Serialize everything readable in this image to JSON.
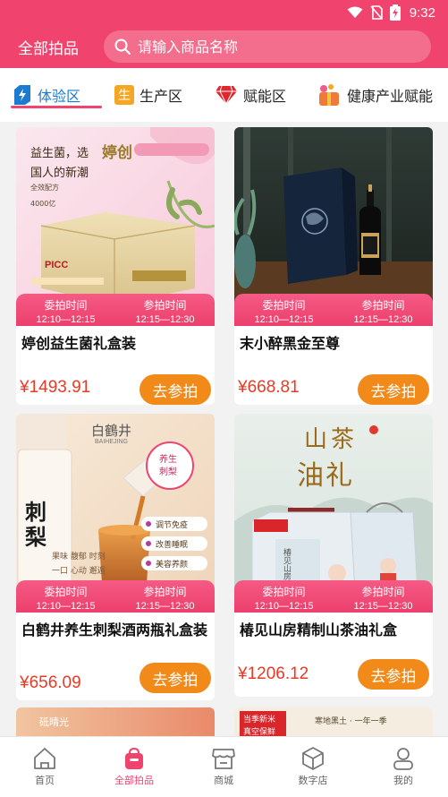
{
  "status_bar": {
    "time": "9:32",
    "icons": [
      "wifi-icon",
      "no-sim-icon",
      "battery-charging-icon"
    ]
  },
  "header": {
    "title": "全部拍品",
    "search_placeholder": "请输入商品名称"
  },
  "tabs": [
    {
      "label": "体验区",
      "icon": "lightning-tag-icon",
      "active": true
    },
    {
      "label": "生产区",
      "icon": "production-badge-icon",
      "active": false
    },
    {
      "label": "赋能区",
      "icon": "diamond-icon",
      "active": false
    },
    {
      "label": "健康产业赋能",
      "icon": "gift-bag-icon",
      "active": false
    }
  ],
  "time_labels": {
    "entrust": "委拍时间",
    "join": "参拍时间"
  },
  "products": [
    {
      "name": "婷创益生菌礼盒装",
      "entrust_time": "12:10—12:15",
      "join_time": "12:15—12:30",
      "price": "¥1493.91",
      "button": "去参拍",
      "image_text": {
        "line1": "益生菌，选",
        "brand": "婷创",
        "line2": "国人的新潮",
        "badge1": "全效配方",
        "badge2": "4000亿",
        "logo": "PICC"
      }
    },
    {
      "name": "末小醉黑金至尊",
      "entrust_time": "12:10—12:15",
      "join_time": "12:15—12:30",
      "price": "¥668.81",
      "button": "去参拍"
    },
    {
      "name": "白鹤井养生刺梨酒两瓶礼盒装",
      "entrust_time": "12:10—12:15",
      "join_time": "12:15—12:30",
      "price": "¥656.09",
      "button": "去参拍",
      "image_text": {
        "brand": "白鶴井",
        "brand_en": "BAIHEJING",
        "bottle": "刺梨",
        "circle_top": "养生",
        "circle_bottom": "刺梨",
        "tag1": "调节免疫",
        "tag2": "改善睡眠",
        "tag3": "美容养颜",
        "slogan1": "果味 馥郁 时刻",
        "slogan2": "一口 心动 邂逅"
      }
    },
    {
      "name": "椿见山房精制山茶油礼盒",
      "entrust_time": "12:10—12:15",
      "join_time": "12:15—12:30",
      "price": "¥1206.12",
      "button": "去参拍",
      "image_text": {
        "title1": "山茶",
        "title2": "油礼",
        "box_text": "椿见山房"
      }
    }
  ],
  "partial_cards": [
    {
      "text": "砥晴光"
    },
    {
      "text1": "当季新米",
      "text2": "真空保鲜",
      "text3": "寒地黑土 · 一年一季"
    }
  ],
  "bottom_nav": [
    {
      "label": "首页",
      "icon": "home-icon",
      "active": false
    },
    {
      "label": "全部拍品",
      "icon": "auction-bag-icon",
      "active": true
    },
    {
      "label": "商城",
      "icon": "store-icon",
      "active": false
    },
    {
      "label": "数字店",
      "icon": "cube-icon",
      "active": false
    },
    {
      "label": "我的",
      "icon": "user-icon",
      "active": false
    }
  ]
}
